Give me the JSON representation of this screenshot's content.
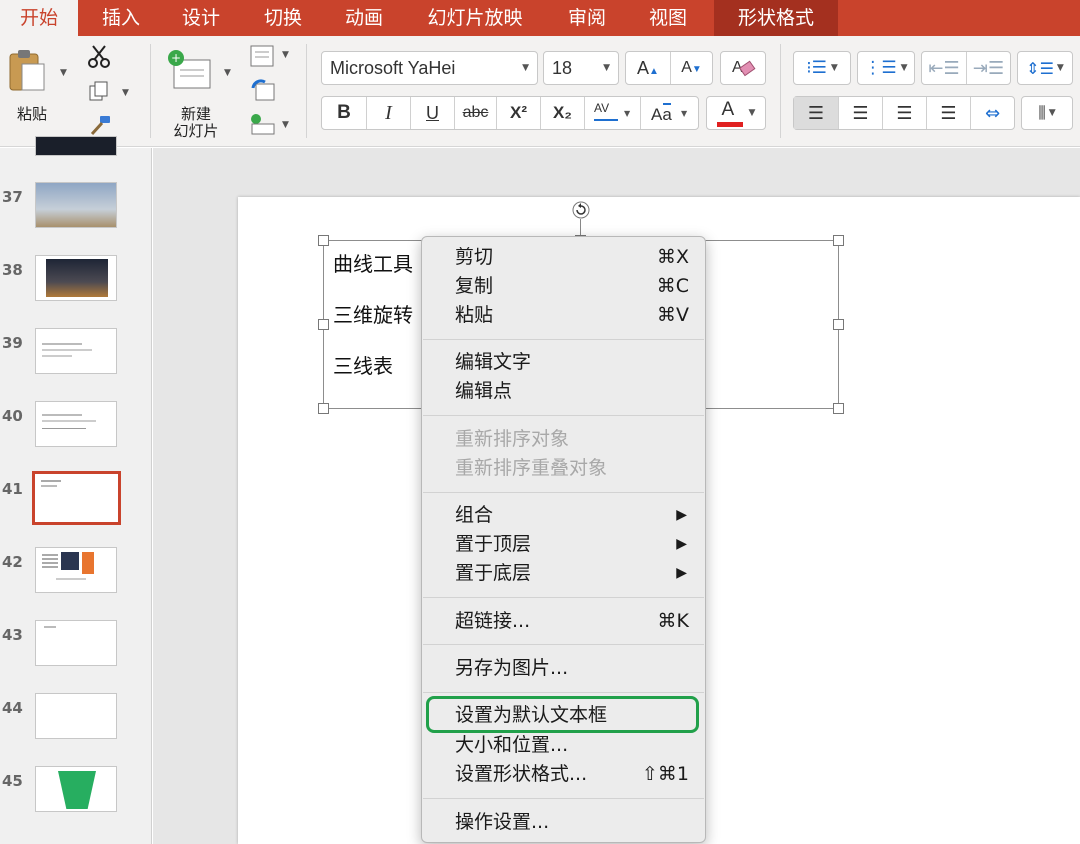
{
  "tabs": [
    {
      "label": "开始"
    },
    {
      "label": "插入"
    },
    {
      "label": "设计"
    },
    {
      "label": "切换"
    },
    {
      "label": "动画"
    },
    {
      "label": "幻灯片放映"
    },
    {
      "label": "审阅"
    },
    {
      "label": "视图"
    },
    {
      "label": "形状格式"
    }
  ],
  "ribbon": {
    "paste_label": "粘贴",
    "new_slide_label_1": "新建",
    "new_slide_label_2": "幻灯片",
    "font_name": "Microsoft YaHei",
    "font_size": "18",
    "bold": "B",
    "italic": "I",
    "underline": "U",
    "strikethrough": "abc",
    "superscript": "X²",
    "subscript": "X₂",
    "font_color_letter": "A"
  },
  "colors": {
    "accent": "#c9432c",
    "highlight_box": "#21a04a",
    "font_color_bar": "#e02020"
  },
  "slides": [
    {
      "number": "37"
    },
    {
      "number": "38"
    },
    {
      "number": "39"
    },
    {
      "number": "40"
    },
    {
      "number": "41"
    },
    {
      "number": "42"
    },
    {
      "number": "43"
    },
    {
      "number": "44"
    },
    {
      "number": "45"
    }
  ],
  "textbox": {
    "lines": [
      "曲线工具",
      "三维旋转",
      "三线表"
    ]
  },
  "context_menu": {
    "items": [
      {
        "label": "剪切",
        "shortcut": "⌘X"
      },
      {
        "label": "复制",
        "shortcut": "⌘C"
      },
      {
        "label": "粘贴",
        "shortcut": "⌘V"
      },
      {
        "label": "编辑文字"
      },
      {
        "label": "编辑点"
      },
      {
        "label": "重新排序对象",
        "disabled": true
      },
      {
        "label": "重新排序重叠对象",
        "disabled": true
      },
      {
        "label": "组合",
        "submenu": true
      },
      {
        "label": "置于顶层",
        "submenu": true
      },
      {
        "label": "置于底层",
        "submenu": true
      },
      {
        "label": "超链接...",
        "shortcut": "⌘K"
      },
      {
        "label": "另存为图片..."
      },
      {
        "label": "设置为默认文本框",
        "highlighted": true
      },
      {
        "label": "大小和位置..."
      },
      {
        "label": "设置形状格式...",
        "shortcut": "⇧⌘1"
      },
      {
        "label": "操作设置..."
      }
    ]
  }
}
